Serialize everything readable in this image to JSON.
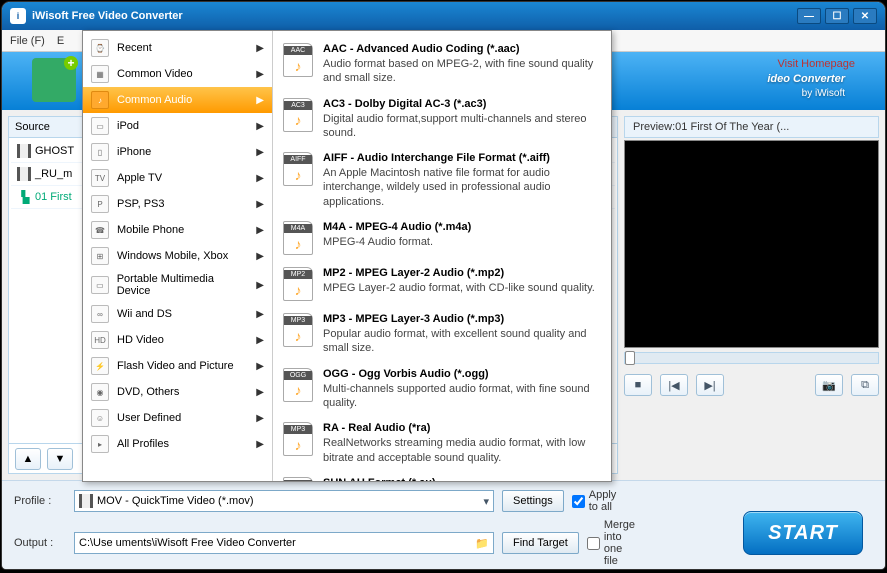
{
  "title": "iWisoft Free Video Converter",
  "menu": {
    "file": "File (F)",
    "e": "E"
  },
  "homepage": "Visit Homepage",
  "brand": {
    "main": "ideo Converter",
    "sub": "by iWisoft"
  },
  "source_header": "Source",
  "sources": [
    {
      "name": "GHOST"
    },
    {
      "name": "_RU_m"
    },
    {
      "name": "01 First"
    }
  ],
  "preview_label": "Preview:01 First Of The Year (...",
  "categories": [
    {
      "label": "Recent",
      "icon": "⌚"
    },
    {
      "label": "Common Video",
      "icon": "▦"
    },
    {
      "label": "Common Audio",
      "icon": "♪",
      "active": true
    },
    {
      "label": "iPod",
      "icon": "▭"
    },
    {
      "label": "iPhone",
      "icon": "▯"
    },
    {
      "label": "Apple TV",
      "icon": "TV"
    },
    {
      "label": "PSP, PS3",
      "icon": "P"
    },
    {
      "label": "Mobile Phone",
      "icon": "☎"
    },
    {
      "label": "Windows Mobile, Xbox",
      "icon": "⊞"
    },
    {
      "label": "Portable Multimedia Device",
      "icon": "▭"
    },
    {
      "label": "Wii and DS",
      "icon": "∞"
    },
    {
      "label": "HD Video",
      "icon": "HD"
    },
    {
      "label": "Flash Video and Picture",
      "icon": "⚡"
    },
    {
      "label": "DVD, Others",
      "icon": "◉"
    },
    {
      "label": "User Defined",
      "icon": "☺"
    },
    {
      "label": "All Profiles",
      "icon": "▸"
    }
  ],
  "formats": [
    {
      "tag": "AAC",
      "title": "AAC - Advanced Audio Coding (*.aac)",
      "desc": "Audio format based on MPEG-2, with fine sound quality and small size."
    },
    {
      "tag": "AC3",
      "title": "AC3 - Dolby Digital AC-3 (*.ac3)",
      "desc": "Digital audio format,support multi-channels and stereo sound."
    },
    {
      "tag": "AIFF",
      "title": "AIFF - Audio Interchange File Format (*.aiff)",
      "desc": "An Apple Macintosh native file format for audio interchange, wildely used in professional audio applications."
    },
    {
      "tag": "M4A",
      "title": "M4A - MPEG-4 Audio (*.m4a)",
      "desc": "MPEG-4 Audio format."
    },
    {
      "tag": "MP2",
      "title": "MP2 - MPEG Layer-2 Audio (*.mp2)",
      "desc": "MPEG Layer-2 audio format, with CD-like sound quality."
    },
    {
      "tag": "MP3",
      "title": "MP3 - MPEG Layer-3 Audio (*.mp3)",
      "desc": "Popular audio format, with excellent sound quality and small size."
    },
    {
      "tag": "OGG",
      "title": "OGG - Ogg Vorbis Audio (*.ogg)",
      "desc": "Multi-channels supported audio format, with fine sound quality."
    },
    {
      "tag": "MP3",
      "title": "RA - Real Audio (*ra)",
      "desc": "RealNetworks streaming media audio format, with low bitrate and acceptable sound quality."
    },
    {
      "tag": "AU",
      "title": "SUN AU Format (*.au)",
      "desc": ""
    }
  ],
  "profile": {
    "label": "Profile :",
    "value": "MOV - QuickTime Video (*.mov)"
  },
  "output": {
    "label": "Output :",
    "value": "C:\\Use              uments\\iWisoft Free Video Converter"
  },
  "buttons": {
    "settings": "Settings",
    "find_target": "Find Target",
    "start": "START"
  },
  "checks": {
    "apply_all": "Apply to all",
    "merge": "Merge into one file"
  }
}
